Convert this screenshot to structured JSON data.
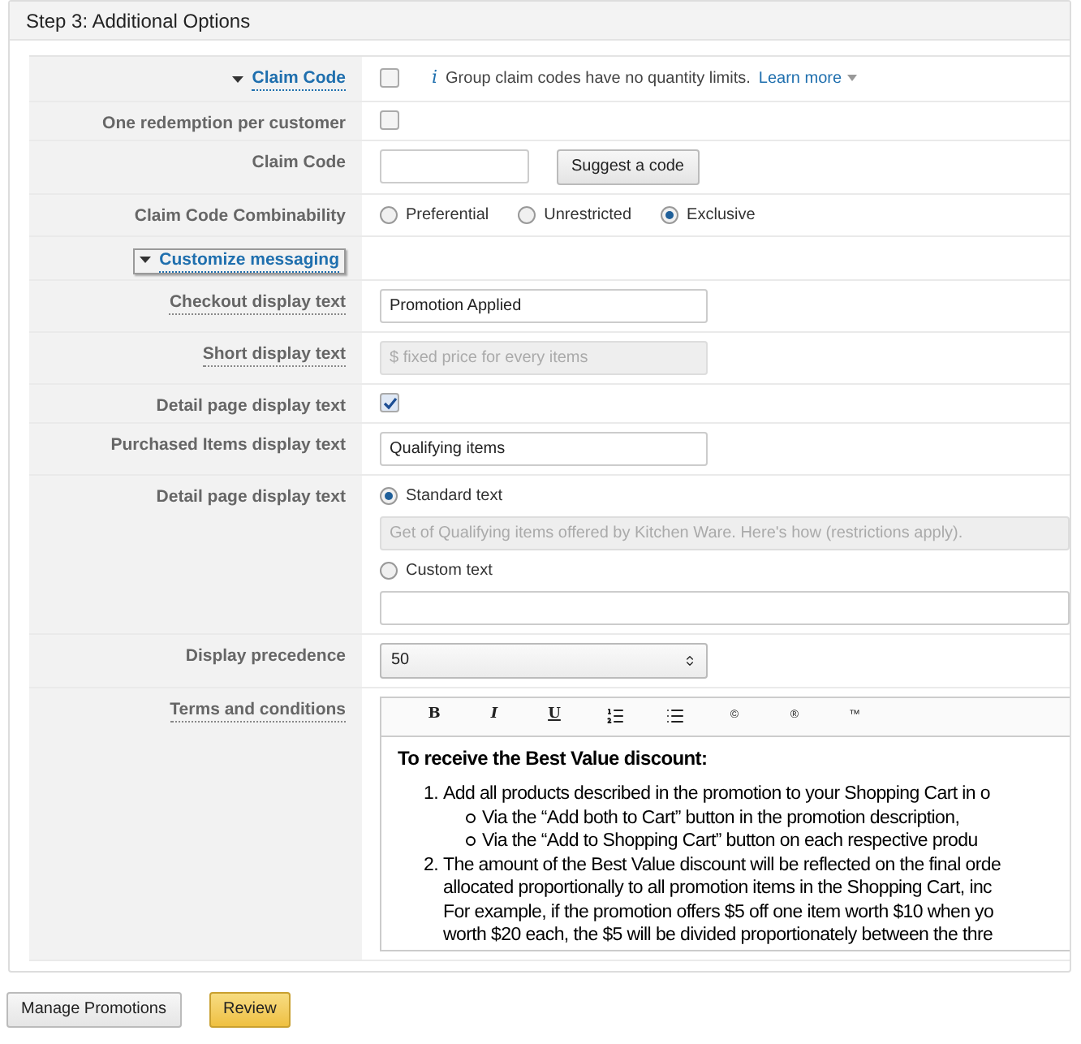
{
  "header": {
    "title": "Step 3: Additional Options"
  },
  "rows": [
    {
      "kind": "checkbox",
      "label": "Claim Code",
      "toggle": true,
      "underlined": true,
      "expanded": true,
      "checked": false,
      "info": {
        "icon": "i",
        "text": "Group claim codes have no quantity limits.",
        "link": "Learn more"
      }
    },
    {
      "kind": "checkbox",
      "label": "One redemption per customer",
      "toggle": false,
      "underlined": false,
      "checked": false
    },
    {
      "kind": "input_button",
      "label": "Claim Code",
      "toggle": false,
      "underlined": false,
      "button": "Suggest a code"
    },
    {
      "kind": "radios",
      "label": "Claim Code Combinability",
      "toggle": false,
      "underlined": false,
      "options": [
        {
          "label": "Preferential",
          "selected": false
        },
        {
          "label": "Unrestricted",
          "selected": false
        },
        {
          "label": "Exclusive",
          "selected": true
        }
      ]
    },
    {
      "kind": "section",
      "label": "Customize messaging",
      "toggle": true,
      "underlined": true,
      "expanded": true
    },
    {
      "kind": "input",
      "label": "Checkout display text",
      "toggle": false,
      "underlined": true,
      "value": "Promotion Applied",
      "disabled": false
    },
    {
      "kind": "input",
      "label": "Short display text",
      "toggle": false,
      "underlined": true,
      "value": "$ fixed price for every  items",
      "disabled": true
    },
    {
      "kind": "checkbox",
      "label": "Detail page display text",
      "toggle": false,
      "underlined": false,
      "checked": true
    },
    {
      "kind": "input",
      "label": "Purchased Items display text",
      "toggle": false,
      "underlined": false,
      "value": "Qualifying items",
      "disabled": false
    },
    {
      "kind": "detail",
      "label": "Detail page display text",
      "toggle": false,
      "underlined": false,
      "options": [
        {
          "label": "Standard text",
          "selected": true,
          "value": "Get of Qualifying items offered by Kitchen Ware. Here's how (restrictions apply).",
          "disabled": true
        },
        {
          "label": "Custom text",
          "selected": false,
          "disabled": false
        }
      ]
    },
    {
      "kind": "select",
      "label": "Display precedence",
      "toggle": false,
      "underlined": false,
      "value": "50"
    },
    {
      "kind": "editor",
      "label": "Terms and conditions",
      "toggle": false,
      "underlined": true,
      "toolbar": [
        {
          "kind": "bold",
          "label": "B"
        },
        {
          "kind": "italic",
          "label": "I"
        },
        {
          "kind": "underline",
          "label": "U"
        },
        {
          "kind": "ordered-list"
        },
        {
          "kind": "bullet-list"
        },
        {
          "kind": "symbol",
          "label": "©"
        },
        {
          "kind": "symbol",
          "label": "®"
        },
        {
          "kind": "symbol",
          "label": "™"
        }
      ],
      "heading": "To receive the Best Value discount:",
      "items": [
        {
          "number": "1.",
          "lines": [
            "Add all products described in the promotion to your Shopping Cart in o"
          ],
          "children": [
            {
              "text": "Via the “Add both to Cart” button in the promotion description,"
            },
            {
              "text": "Via the “Add to Shopping Cart” button on each respective produ"
            }
          ]
        },
        {
          "number": "2.",
          "lines": [
            "The amount of the Best Value discount will be reflected on the final orde",
            "allocated proportionally to all promotion items in the Shopping Cart, inc",
            "For example, if the promotion offers $5 off one item worth $10 when yo",
            "worth $20 each, the $5 will be divided proportionately between the thre"
          ]
        }
      ]
    }
  ],
  "footer": {
    "buttons": [
      {
        "label": "Manage Promotions",
        "primary": false
      },
      {
        "label": "Review",
        "primary": true
      }
    ]
  }
}
